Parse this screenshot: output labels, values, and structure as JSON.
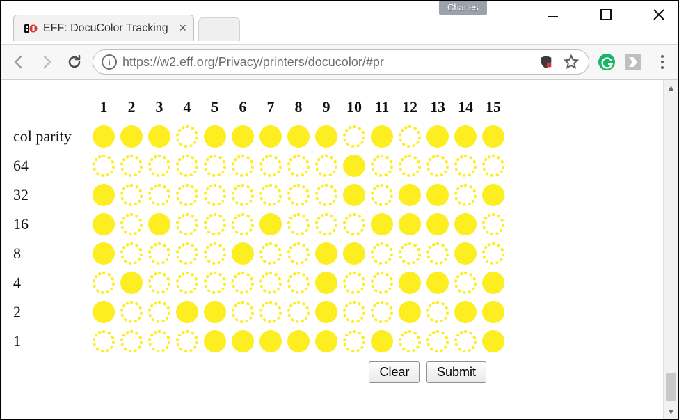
{
  "window": {
    "profile": "Charles"
  },
  "tab": {
    "title": "EFF: DocuColor Tracking"
  },
  "toolbar": {
    "url_display": "https://w2.eff.org/Privacy/printers/docucolor/#pr"
  },
  "page": {
    "col_headers": [
      "1",
      "2",
      "3",
      "4",
      "5",
      "6",
      "7",
      "8",
      "9",
      "10",
      "11",
      "12",
      "13",
      "14",
      "15"
    ],
    "row_labels": [
      "col parity",
      "64",
      "32",
      "16",
      "8",
      "4",
      "2",
      "1"
    ],
    "grid": [
      [
        1,
        1,
        1,
        0,
        1,
        1,
        1,
        1,
        1,
        0,
        1,
        0,
        1,
        1,
        1
      ],
      [
        0,
        0,
        0,
        0,
        0,
        0,
        0,
        0,
        0,
        1,
        0,
        0,
        0,
        0,
        0
      ],
      [
        1,
        0,
        0,
        0,
        0,
        0,
        0,
        0,
        0,
        1,
        0,
        1,
        1,
        0,
        1
      ],
      [
        1,
        0,
        1,
        0,
        0,
        0,
        1,
        0,
        0,
        0,
        1,
        1,
        1,
        1,
        0
      ],
      [
        1,
        0,
        0,
        0,
        0,
        1,
        0,
        0,
        1,
        1,
        0,
        0,
        0,
        1,
        0
      ],
      [
        0,
        1,
        0,
        0,
        0,
        0,
        0,
        0,
        1,
        0,
        0,
        1,
        1,
        0,
        1
      ],
      [
        1,
        0,
        0,
        1,
        1,
        0,
        0,
        0,
        1,
        0,
        0,
        1,
        0,
        1,
        1
      ],
      [
        0,
        0,
        0,
        0,
        1,
        1,
        1,
        1,
        1,
        0,
        1,
        0,
        0,
        0,
        1
      ]
    ],
    "buttons": {
      "clear": "Clear",
      "submit": "Submit"
    }
  }
}
